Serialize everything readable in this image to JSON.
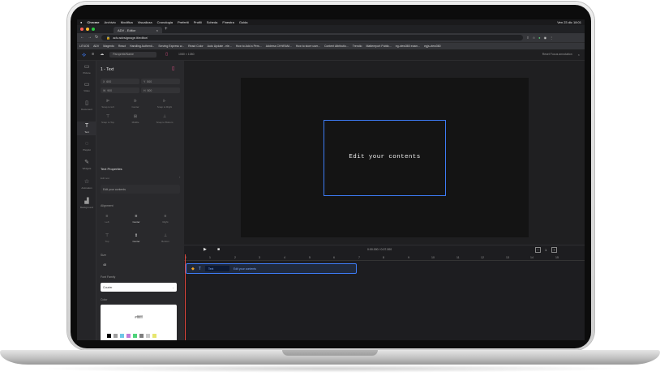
{
  "mac_menu": {
    "app": "Chrome",
    "items": [
      "Archivio",
      "Modifica",
      "Visualizza",
      "Cronologia",
      "Preferiti",
      "Profili",
      "Scheda",
      "Finestra",
      "Guida"
    ],
    "clock": "Ven 23 dic 18:01"
  },
  "browser": {
    "tab_title": "ADV - Editor",
    "url": "adv.advsignage.it/editor/",
    "bookmarks": [
      "LIT4OS",
      "ADV",
      "Magento",
      "React",
      "Handling Authenti...",
      "Serving Express w...",
      "React Color",
      "Auto Update - ele...",
      "How to Add a Pers...",
      "Address Ch%RAM...",
      "How to store user...",
      "Content Attributio...",
      "Trendio",
      "Mattereport Public...",
      "eg-view360 exam...",
      "egjs-view360"
    ]
  },
  "app_header": {
    "project_name": "Paroprete/Name",
    "dimensions": "1080 × 1080",
    "zoom_label": "Reset Focus annotation"
  },
  "sidebar": {
    "items": [
      {
        "icon": "▭",
        "label": "Picture"
      },
      {
        "icon": "▭",
        "label": "Video"
      },
      {
        "icon": "▯",
        "label": "Document"
      },
      {
        "icon": "T",
        "label": "Text"
      },
      {
        "icon": "◌",
        "label": "Playlist"
      },
      {
        "icon": "✎",
        "label": "Widgets"
      },
      {
        "icon": "☆",
        "label": "Animation"
      },
      {
        "icon": "▟",
        "label": "Background"
      }
    ]
  },
  "properties": {
    "title": "1 - Text",
    "pos_x_label": "X",
    "pos_x": "600",
    "pos_y_label": "Y",
    "pos_y": "500",
    "width_label": "W",
    "width": "900",
    "height_label": "H",
    "height": "500",
    "align_objects": [
      "Snap to left",
      "Center",
      "Snap to Right",
      "Snap to Top",
      "Middle",
      "Snap to Bottom"
    ],
    "text_props_title": "Text Properties",
    "text_field_label": "Edit text",
    "text_value": "Edit your contents",
    "alignment_title": "Alignment",
    "alignment_options": [
      "Left",
      "Center",
      "Right"
    ],
    "valign_options": [
      "Top",
      "Center",
      "Bottom"
    ],
    "size_title": "Size",
    "size_value": "48",
    "font_title": "Font Family",
    "font_value": "Courier",
    "color_title": "Color",
    "color_hex": "#ffffff",
    "color_input": "#ffffff",
    "swatches": [
      "#000000",
      "#9e9e9e",
      "#6ec6e6",
      "#c27bd8",
      "#4fd37a",
      "#7e7e7e",
      "#c8c8c8",
      "#e6e66e",
      "#e88a6f",
      "#e87070"
    ]
  },
  "canvas": {
    "text": "Edit your contents"
  },
  "timeline": {
    "time": "0:00.000 / 0:07.000",
    "zoom_value": "1",
    "ruler": [
      "0",
      "1",
      "2",
      "3",
      "4",
      "5",
      "6",
      "7",
      "8",
      "9",
      "10",
      "11",
      "12",
      "13",
      "14",
      "15"
    ],
    "clip_name": "Text",
    "clip_text": "Edit your contents"
  }
}
